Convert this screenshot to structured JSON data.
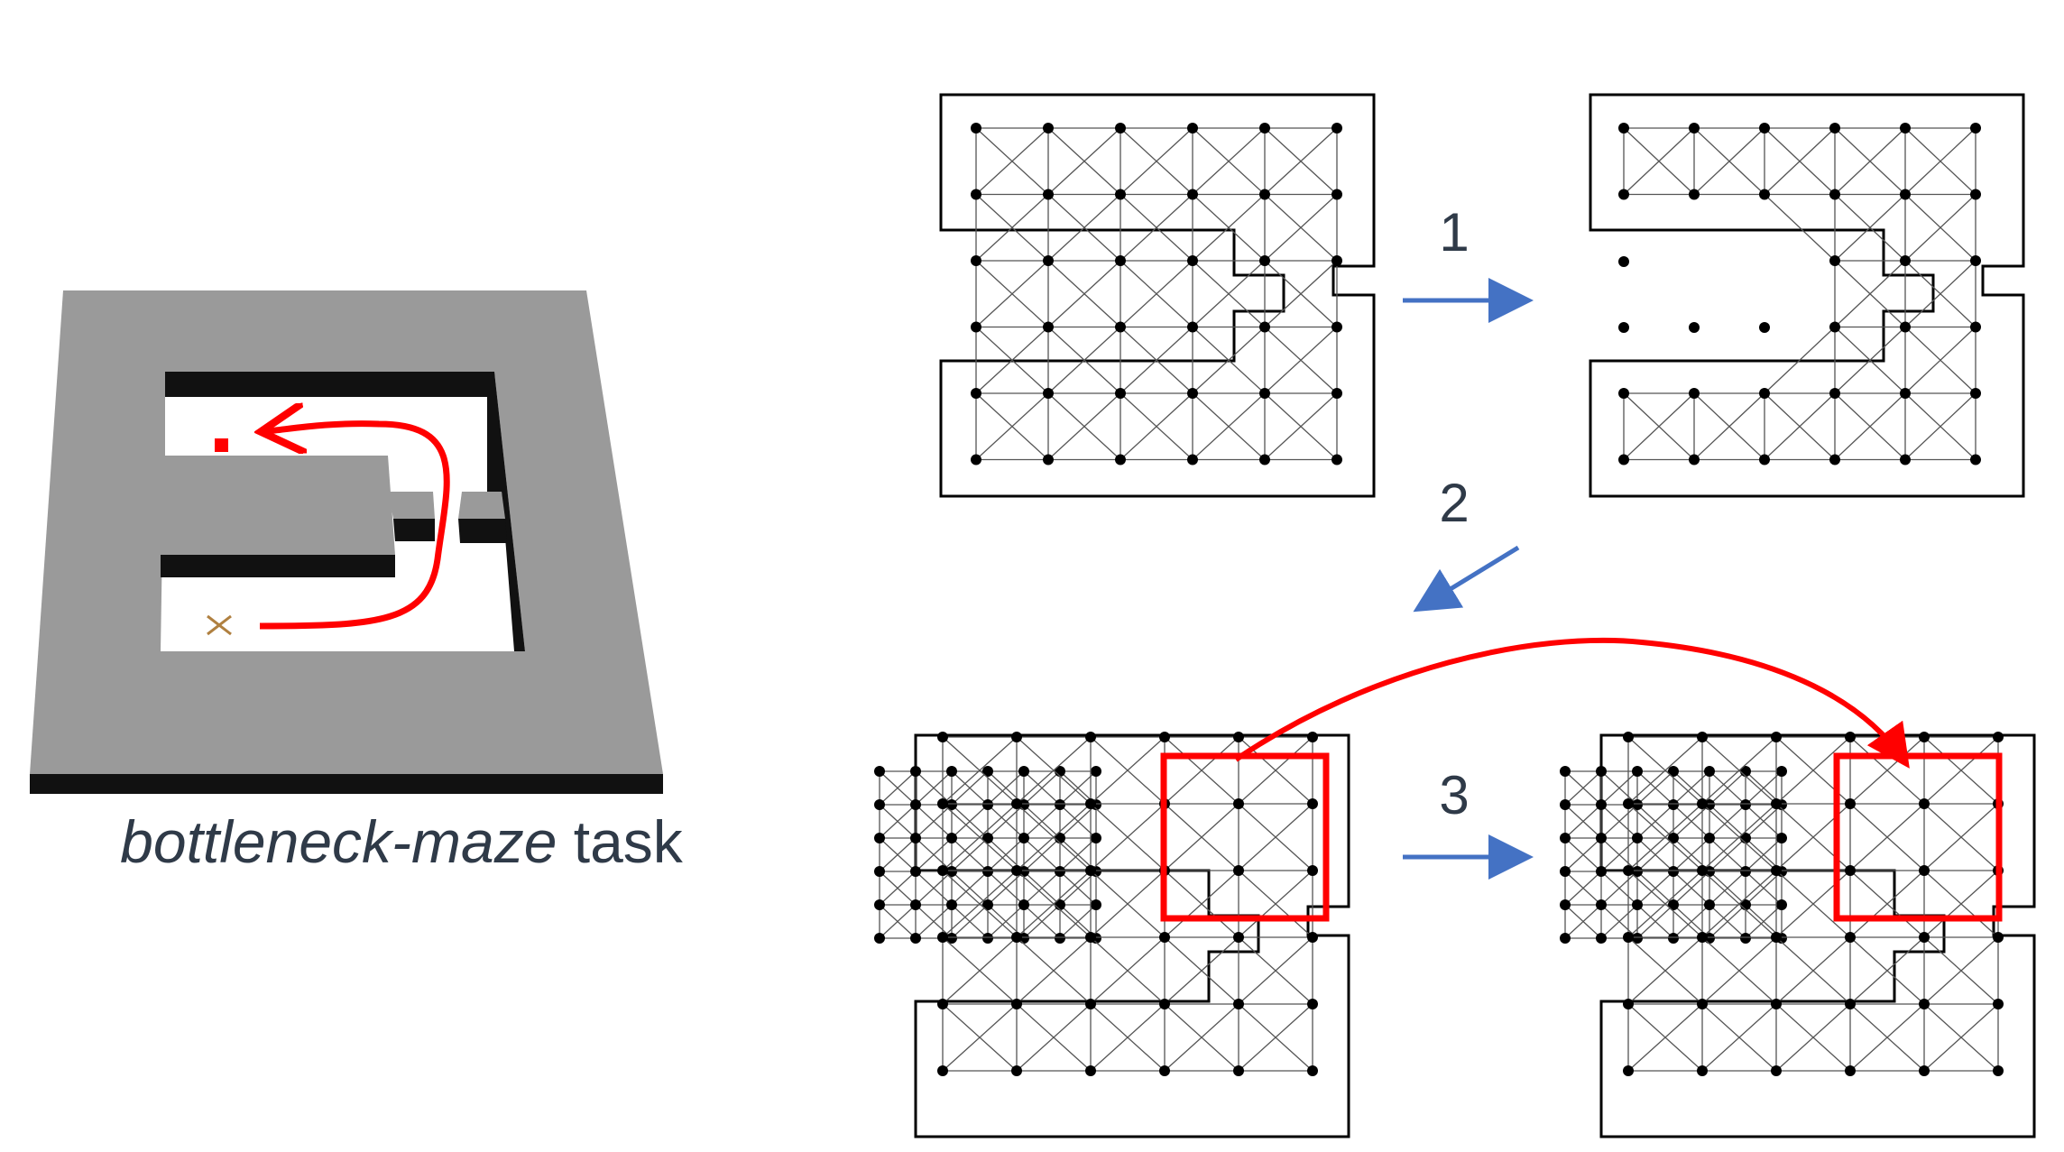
{
  "caption": {
    "task_name": "bottleneck-maze",
    "suffix": " task"
  },
  "steps": [
    {
      "label": "1"
    },
    {
      "label": "2"
    },
    {
      "label": "3"
    }
  ],
  "colors": {
    "wall": "#9a9a9a",
    "wall_shadow": "#1a1a1a",
    "floor": "#ffffff",
    "path": "#ff0000",
    "arrow": "#4472c4",
    "text": "#2f3a48",
    "grid": "#000000",
    "highlight": "#ff0000"
  }
}
